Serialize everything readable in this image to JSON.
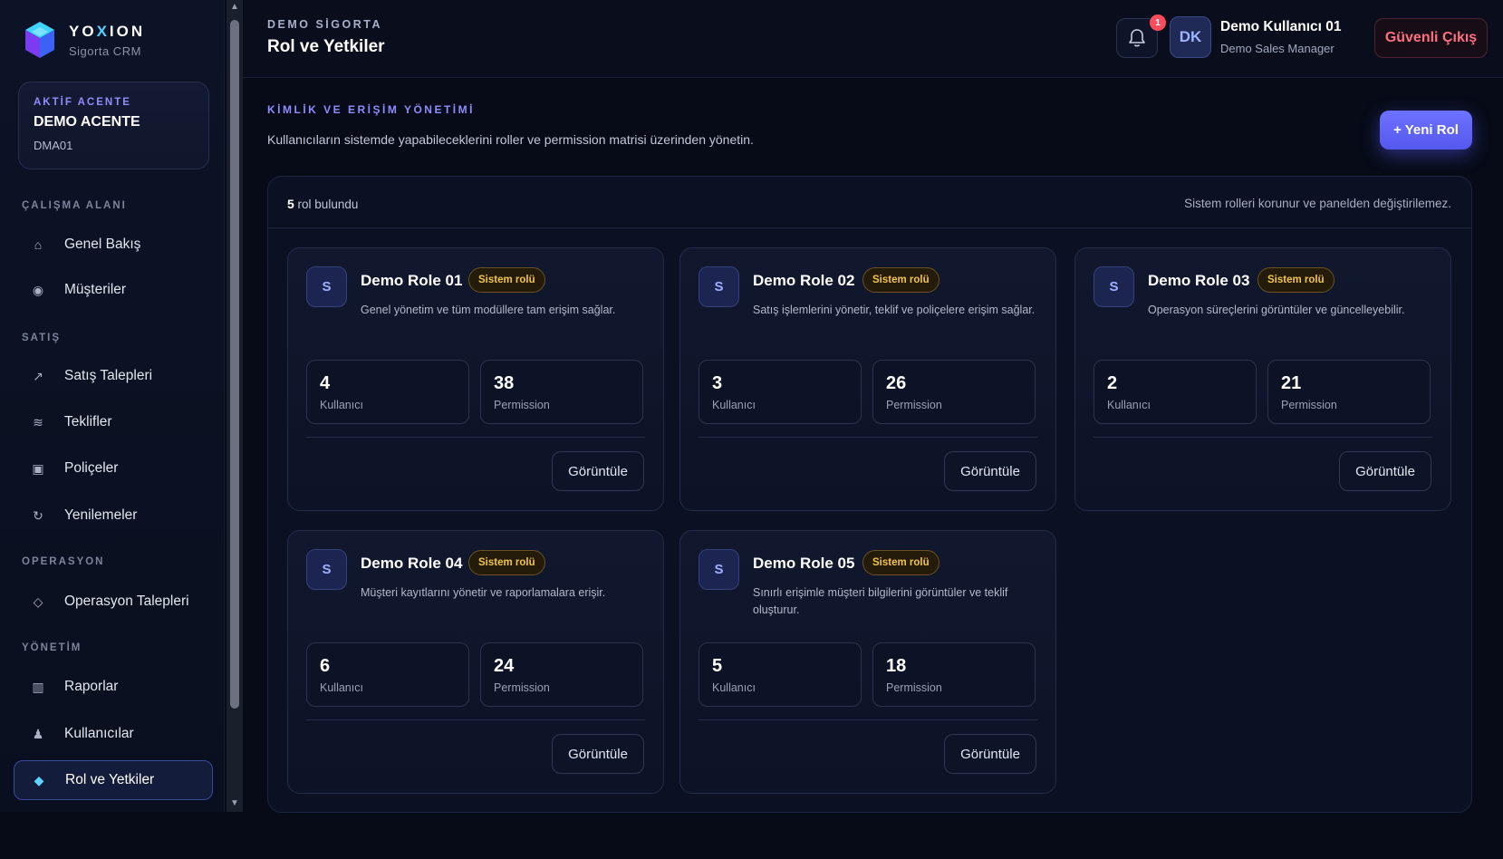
{
  "brand": {
    "name_pre": "YO",
    "name_x": "X",
    "name_post": "ION",
    "subtitle": "Sigorta CRM"
  },
  "agent": {
    "label": "AKTİF ACENTE",
    "name": "DEMO ACENTE",
    "code": "DMA01"
  },
  "nav": {
    "sections": [
      "ÇALIŞMA ALANI",
      "SATIŞ",
      "OPERASYON",
      "YÖNETİM"
    ],
    "items": [
      {
        "label": "Genel Bakış",
        "icon": "⌂"
      },
      {
        "label": "Müşteriler",
        "icon": "◉"
      },
      {
        "label": "Satış Talepleri",
        "icon": "↗"
      },
      {
        "label": "Teklifler",
        "icon": "≋"
      },
      {
        "label": "Poliçeler",
        "icon": "▣"
      },
      {
        "label": "Yenilemeler",
        "icon": "↻"
      },
      {
        "label": "Operasyon Talepleri",
        "icon": "◇"
      },
      {
        "label": "Raporlar",
        "icon": "▥"
      },
      {
        "label": "Kullanıcılar",
        "icon": "♟"
      },
      {
        "label": "Rol ve Yetkiler",
        "icon": "◆"
      }
    ]
  },
  "header": {
    "company": "DEMO SİGORTA",
    "title": "Rol ve Yetkiler",
    "notification_count": "1",
    "avatar_initials": "DK",
    "user_name": "Demo Kullanıcı 01",
    "user_role": "Demo Sales Manager",
    "logout_label": "Güvenli Çıkış"
  },
  "main": {
    "section_label": "KİMLİK VE ERİŞİM YÖNETİMİ",
    "description": "Kullanıcıların sistemde yapabileceklerini roller ve permission matrisi üzerinden yönetin.",
    "new_role_label": "+  Yeni Rol",
    "count_number": "5",
    "count_text": " rol bulundu",
    "note": "Sistem rolleri korunur ve panelden değiştirilemez."
  },
  "roles": [
    {
      "initial": "S",
      "name": "Demo Role 01",
      "badge": "Sistem rolü",
      "description": "Genel yönetim ve tüm modüllere tam erişim sağlar.",
      "users": "4",
      "users_label": "Kullanıcı",
      "permissions": "38",
      "permissions_label": "Permission",
      "view_label": "Görüntüle"
    },
    {
      "initial": "S",
      "name": "Demo Role 02",
      "badge": "Sistem rolü",
      "description": "Satış işlemlerini yönetir, teklif ve poliçelere erişim sağlar.",
      "users": "3",
      "users_label": "Kullanıcı",
      "permissions": "26",
      "permissions_label": "Permission",
      "view_label": "Görüntüle"
    },
    {
      "initial": "S",
      "name": "Demo Role 03",
      "badge": "Sistem rolü",
      "description": "Operasyon süreçlerini görüntüler ve güncelleyebilir.",
      "users": "2",
      "users_label": "Kullanıcı",
      "permissions": "21",
      "permissions_label": "Permission",
      "view_label": "Görüntüle"
    },
    {
      "initial": "S",
      "name": "Demo Role 04",
      "badge": "Sistem rolü",
      "description": "Müşteri kayıtlarını yönetir ve raporlamalara erişir.",
      "users": "6",
      "users_label": "Kullanıcı",
      "permissions": "24",
      "permissions_label": "Permission",
      "view_label": "Görüntüle"
    },
    {
      "initial": "S",
      "name": "Demo Role 05",
      "badge": "Sistem rolü",
      "description": "Sınırlı erişimle müşteri bilgilerini görüntüler ve teklif oluşturur.",
      "users": "5",
      "users_label": "Kullanıcı",
      "permissions": "18",
      "permissions_label": "Permission",
      "view_label": "Görüntüle"
    }
  ],
  "colors": {
    "accent": "#6e72ff",
    "badge": "#f3c44a",
    "danger": "#ff6f7f",
    "background": "#070b17"
  }
}
